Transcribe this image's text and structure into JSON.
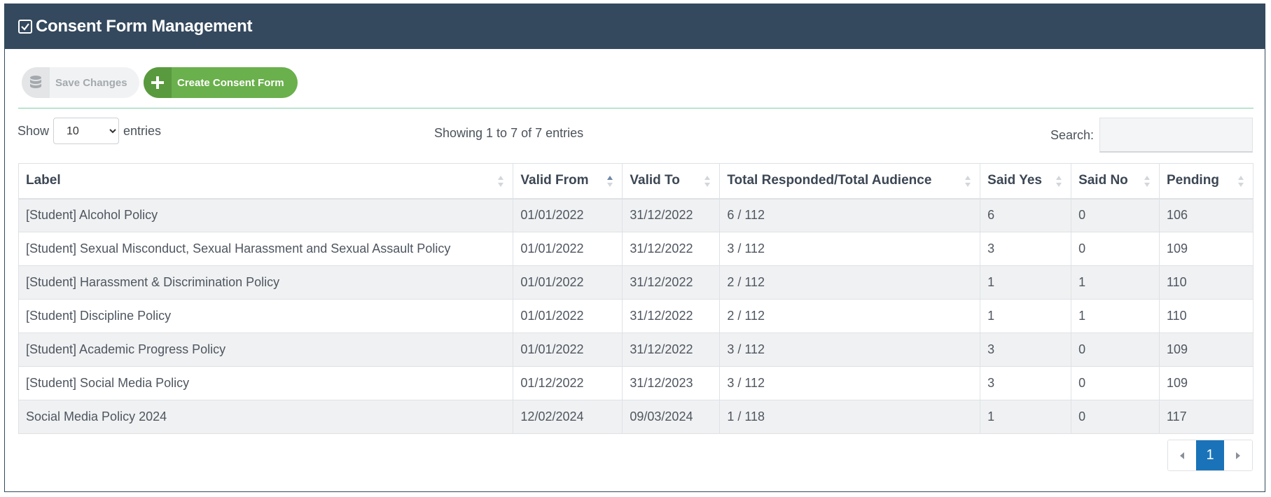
{
  "header": {
    "title": "Consent Form Management",
    "icon": "checkbox-icon"
  },
  "toolbar": {
    "save_label": "Save Changes",
    "save_icon": "database-icon",
    "create_label": "Create Consent Form",
    "create_icon": "plus-icon"
  },
  "length": {
    "show_label": "Show",
    "entries_label": "entries",
    "selected": "10",
    "options": [
      "10"
    ]
  },
  "info": "Showing 1 to 7 of 7 entries",
  "search": {
    "label": "Search:",
    "value": ""
  },
  "table": {
    "columns": [
      "Label",
      "Valid From",
      "Valid To",
      "Total Responded/Total Audience",
      "Said Yes",
      "Said No",
      "Pending"
    ],
    "sorted_column": "Valid From",
    "sort_direction": "ascending",
    "rows": [
      [
        "[Student] Alcohol Policy",
        "01/01/2022",
        "31/12/2022",
        "6 / 112",
        "6",
        "0",
        "106"
      ],
      [
        "[Student] Sexual Misconduct, Sexual Harassment and Sexual Assault Policy",
        "01/01/2022",
        "31/12/2022",
        "3 / 112",
        "3",
        "0",
        "109"
      ],
      [
        "[Student] Harassment & Discrimination Policy",
        "01/01/2022",
        "31/12/2022",
        "2 / 112",
        "1",
        "1",
        "110"
      ],
      [
        "[Student] Discipline Policy",
        "01/01/2022",
        "31/12/2022",
        "2 / 112",
        "1",
        "1",
        "110"
      ],
      [
        "[Student] Academic Progress Policy",
        "01/01/2022",
        "31/12/2022",
        "3 / 112",
        "3",
        "0",
        "109"
      ],
      [
        "[Student] Social Media Policy",
        "01/12/2022",
        "31/12/2023",
        "3 / 112",
        "3",
        "0",
        "109"
      ],
      [
        "Social Media Policy 2024",
        "12/02/2024",
        "09/03/2024",
        "1 / 118",
        "1",
        "0",
        "117"
      ]
    ]
  },
  "pagination": {
    "current": "1"
  },
  "colors": {
    "header_bg": "#34495e",
    "create_button": "#6ab04c",
    "page_active": "#1a73b8",
    "divider": "#7fcfa9"
  }
}
